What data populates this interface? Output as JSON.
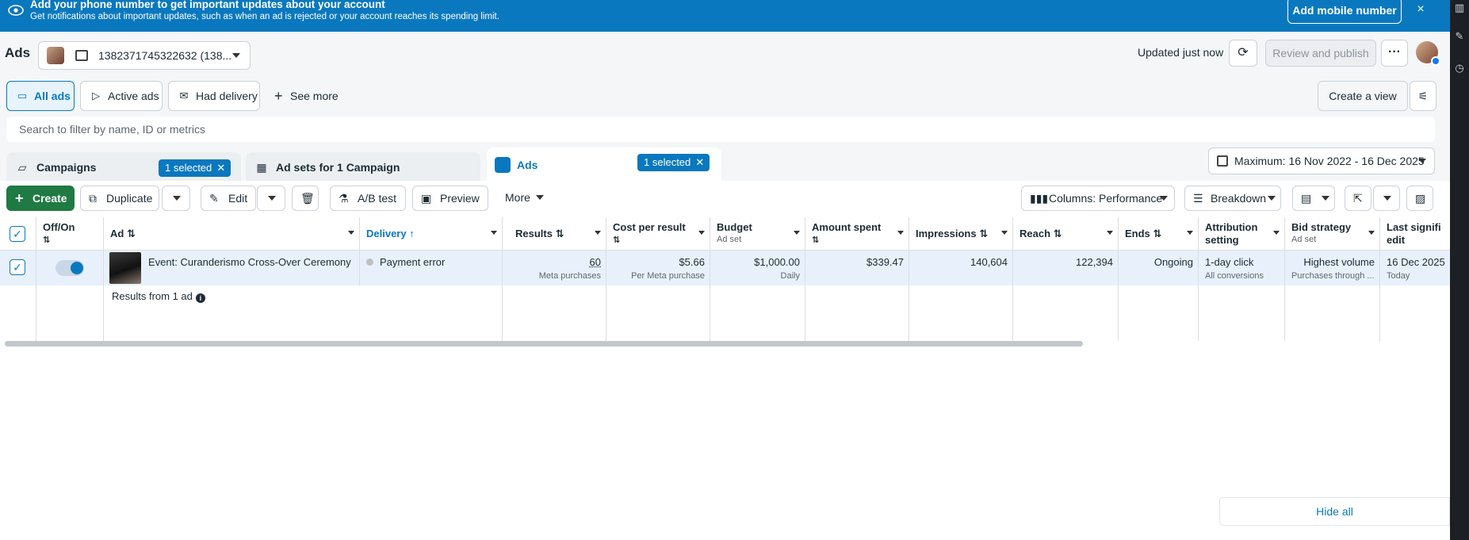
{
  "banner": {
    "title": "Add your phone number to get important updates about your account",
    "subtitle": "Get notifications about important updates, such as when an ad is rejected or your account reaches its spending limit.",
    "action_label": "Add mobile number",
    "close_symbol": "×"
  },
  "header": {
    "app_title": "Ads",
    "account_label": "1382371745322632 (138...",
    "updated_text": "Updated just now",
    "refresh_symbol": "⟳",
    "review_label": "Review and publish",
    "more_symbol": "···"
  },
  "views": {
    "items": [
      {
        "label": "All ads",
        "icon": "folder-icon",
        "symbol": "▭"
      },
      {
        "label": "Active ads",
        "icon": "send-icon",
        "symbol": "▷"
      },
      {
        "label": "Had delivery",
        "icon": "envelope-open-icon",
        "symbol": "✉"
      }
    ],
    "see_more_label": "See more",
    "create_view_label": "Create a view",
    "settings_symbol": "⚟"
  },
  "search": {
    "placeholder": "Search to filter by name, ID or metrics"
  },
  "levels": {
    "campaigns": {
      "label": "Campaigns",
      "chip": "1 selected"
    },
    "adsets": {
      "label": "Ad sets for 1 Campaign"
    },
    "ads": {
      "label": "Ads",
      "chip": "1 selected"
    },
    "chip_close": "✕",
    "date_range": "Maximum: 16 Nov 2022 - 16 Dec 2025"
  },
  "toolbar": {
    "create_label": "Create",
    "duplicate_label": "Duplicate",
    "edit_label": "Edit",
    "ab_test_label": "A/B test",
    "preview_label": "Preview",
    "more_label": "More",
    "columns_label": "Columns: Performance",
    "breakdown_label": "Breakdown"
  },
  "table": {
    "columns": {
      "offon": {
        "title": "Off/On",
        "sort": "⇅"
      },
      "ad": {
        "title": "Ad ⇅"
      },
      "delivery": {
        "title": "Delivery ↑"
      },
      "results": {
        "title": "Results ⇅"
      },
      "cpr": {
        "title": "Cost per result",
        "sort": "⇅"
      },
      "budget": {
        "title": "Budget",
        "sub": "Ad set"
      },
      "spent": {
        "title": "Amount spent",
        "sort": "⇅"
      },
      "impressions": {
        "title": "Impressions ⇅"
      },
      "reach": {
        "title": "Reach ⇅"
      },
      "ends": {
        "title": "Ends ⇅"
      },
      "attribution": {
        "title": "Attribution",
        "title2": "setting"
      },
      "bid": {
        "title": "Bid strategy",
        "sub": "Ad set"
      },
      "lastedit": {
        "title": "Last signifi",
        "title2": "edit"
      }
    },
    "row": {
      "check": "✓",
      "ad_name": "Event: Curanderismo Cross-Over Ceremony",
      "delivery": "Payment error",
      "results": "60",
      "results_sub": "Meta purchases",
      "cpr": "$5.66",
      "cpr_sub": "Per Meta purchase",
      "budget": "$1,000.00",
      "budget_sub": "Daily",
      "spent": "$339.47",
      "impressions": "140,604",
      "reach": "122,394",
      "ends": "Ongoing",
      "attribution": "1-day click",
      "attribution_sub": "All conversions",
      "bid": "Highest volume",
      "bid_sub": "Purchases through ...",
      "lastedit": "16 Dec 2025",
      "lastedit_sub": "Today"
    },
    "summary": "Results from 1 ad",
    "info_symbol": "i"
  },
  "footer": {
    "hide_all_label": "Hide all"
  }
}
